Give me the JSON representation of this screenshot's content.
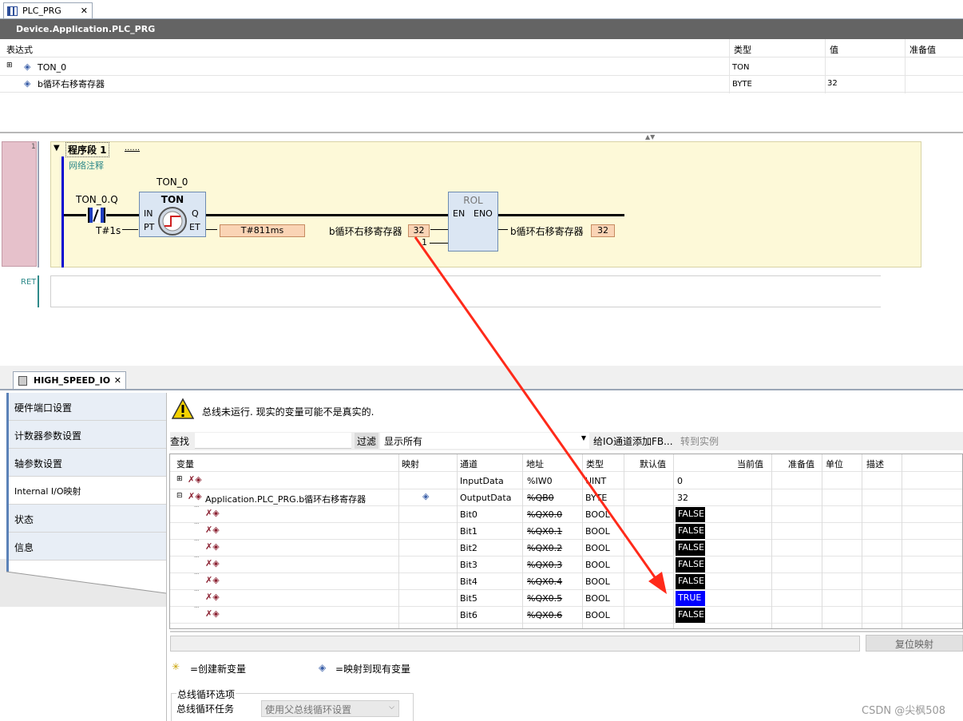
{
  "editor_tab": {
    "label": "PLC_PRG"
  },
  "title": "Device.Application.PLC_PRG",
  "watch": {
    "headers": [
      "表达式",
      "类型",
      "值",
      "准备值"
    ],
    "rows": [
      {
        "expand": "⊞",
        "name": "TON_0",
        "type": "TON",
        "value": ""
      },
      {
        "expand": "",
        "name": "b循环右移寄存器",
        "type": "BYTE",
        "value": "32"
      }
    ]
  },
  "ladder": {
    "network_number": "1",
    "network_title": "程序段  1",
    "network_dots": "......",
    "network_comment": "网络注释",
    "contact_label": "TON_0.Q",
    "instance_label": "TON_0",
    "ton": {
      "title": "TON",
      "in": "IN",
      "q": "Q",
      "pt": "PT",
      "et": "ET",
      "pt_value": "T#1s",
      "et_value": "T#811ms"
    },
    "rol": {
      "title": "ROL",
      "en": "EN",
      "eno": "ENO",
      "in_var": "b循环右移寄存器",
      "in_value": "32",
      "n_value": "1",
      "out_var": "b循环右移寄存器",
      "out_value": "32"
    },
    "ret": "RET"
  },
  "io_tab": {
    "label": "HIGH_SPEED_IO"
  },
  "sidebar": {
    "items": [
      {
        "label": "硬件端口设置"
      },
      {
        "label": "计数器参数设置"
      },
      {
        "label": "轴参数设置"
      },
      {
        "label": "Internal I/O映射"
      },
      {
        "label": "状态"
      },
      {
        "label": "信息"
      }
    ]
  },
  "warning": "总线未运行. 现实的变量可能不是真实的.",
  "toolbar": {
    "find": "查找",
    "filter": "过滤",
    "filter_value": "显示所有",
    "add_fb": "给IO通道添加FB...",
    "goto_instance": "转到实例"
  },
  "grid": {
    "headers": [
      "变量",
      "映射",
      "通道",
      "地址",
      "类型",
      "默认值",
      "当前值",
      "准备值",
      "单位",
      "描述"
    ],
    "rows": [
      {
        "variable": "",
        "channel": "InputData",
        "address": "%IW0",
        "type": "UINT",
        "current": "0",
        "kind": "plain",
        "strike": false
      },
      {
        "variable": "Application.PLC_PRG.b循环右移寄存器",
        "channel": "OutputData",
        "address": "%QB0",
        "type": "BYTE",
        "current": "32",
        "kind": "plain",
        "strike": true
      },
      {
        "variable": "",
        "channel": "Bit0",
        "address": "%QX0.0",
        "type": "BOOL",
        "current": "FALSE",
        "kind": "false",
        "strike": true
      },
      {
        "variable": "",
        "channel": "Bit1",
        "address": "%QX0.1",
        "type": "BOOL",
        "current": "FALSE",
        "kind": "false",
        "strike": true
      },
      {
        "variable": "",
        "channel": "Bit2",
        "address": "%QX0.2",
        "type": "BOOL",
        "current": "FALSE",
        "kind": "false",
        "strike": true
      },
      {
        "variable": "",
        "channel": "Bit3",
        "address": "%QX0.3",
        "type": "BOOL",
        "current": "FALSE",
        "kind": "false",
        "strike": true
      },
      {
        "variable": "",
        "channel": "Bit4",
        "address": "%QX0.4",
        "type": "BOOL",
        "current": "FALSE",
        "kind": "false",
        "strike": true
      },
      {
        "variable": "",
        "channel": "Bit5",
        "address": "%QX0.5",
        "type": "BOOL",
        "current": "TRUE",
        "kind": "true",
        "strike": true
      },
      {
        "variable": "",
        "channel": "Bit6",
        "address": "%QX0.6",
        "type": "BOOL",
        "current": "FALSE",
        "kind": "false",
        "strike": true
      }
    ]
  },
  "reset_button": "复位映射",
  "legend": {
    "new_var": "=创建新变量",
    "map_existing": "=映射到现有变量"
  },
  "bus_cycle": {
    "group_label": "总线循环选项",
    "task_label": "总线循环任务",
    "task_value": "使用父总线循环设置"
  },
  "watermark": "CSDN @尖枫508",
  "colors": {
    "title_bg": "#646464",
    "false_bg": "#000000",
    "true_bg": "#0000ff",
    "arrow": "#ff2a1a",
    "network_bg": "#fdf9d8",
    "value_box": "#fad4b5"
  }
}
